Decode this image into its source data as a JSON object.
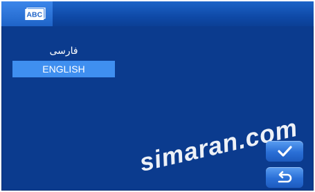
{
  "header": {
    "icon": "abc-keyboard-icon",
    "icon_text": "ABC"
  },
  "languages": [
    {
      "label": "فارسی",
      "selected": false
    },
    {
      "label": "ENGLISH",
      "selected": true
    }
  ],
  "buttons": {
    "confirm_icon": "checkmark-icon",
    "back_icon": "return-arrow-icon"
  },
  "watermark": {
    "text": "simaran.com"
  },
  "colors": {
    "background": "#0b3b8e",
    "header": "#0f4aa8",
    "selection": "#3f8ff0",
    "button": "#2a6fd6"
  }
}
